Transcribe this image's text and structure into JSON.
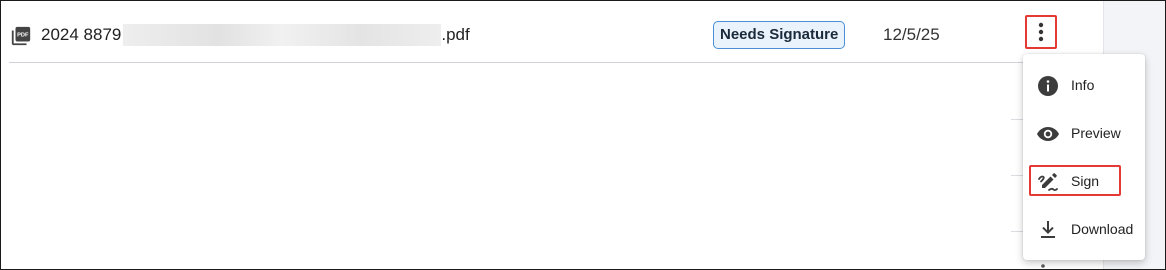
{
  "file_row": {
    "file_name_prefix": "2024 8879",
    "file_name_suffix": ".pdf",
    "status_badge": "Needs Signature",
    "date": "12/5/25",
    "file_icon": "pdf-file-icon",
    "more_icon": "more-vert-icon"
  },
  "context_menu": {
    "items": [
      {
        "label": "Info",
        "icon": "info-icon"
      },
      {
        "label": "Preview",
        "icon": "eye-icon"
      },
      {
        "label": "Sign",
        "icon": "signature-pen-icon"
      },
      {
        "label": "Download",
        "icon": "download-icon"
      }
    ]
  },
  "colors": {
    "badge_border": "#4a8fd6",
    "badge_background": "#eaf3fc",
    "highlight_annotation": "#e53935",
    "icon": "#3c3c3c"
  }
}
